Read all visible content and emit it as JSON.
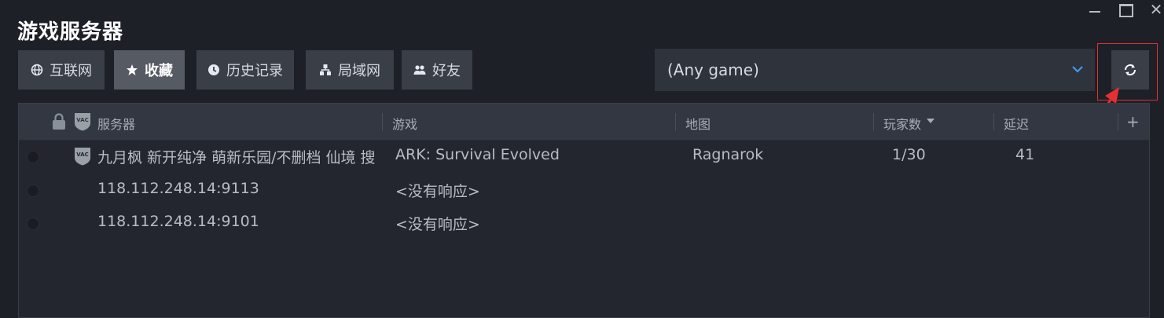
{
  "window": {
    "title": "游戏服务器",
    "close_glyph": "✕"
  },
  "tabs": [
    {
      "label": "互联网",
      "icon": "globe-icon",
      "active": false
    },
    {
      "label": "收藏",
      "icon": "star-icon",
      "active": true
    },
    {
      "label": "历史记录",
      "icon": "clock-icon",
      "active": false
    },
    {
      "label": "局域网",
      "icon": "lan-icon",
      "active": false
    },
    {
      "label": "好友",
      "icon": "friends-icon",
      "active": false
    }
  ],
  "game_filter": {
    "value": "(Any game)"
  },
  "refresh": {
    "icon": "refresh-icon"
  },
  "columns": {
    "server": "服务器",
    "game": "游戏",
    "map": "地图",
    "players": "玩家数",
    "latency": "延迟",
    "add": "+"
  },
  "rows": [
    {
      "vac": true,
      "server": "九月枫 新开纯净 萌新乐园/不删档 仙境 搜",
      "game": "ARK: Survival Evolved",
      "map": "Ragnarok",
      "players": "1/30",
      "latency": "41"
    },
    {
      "vac": false,
      "server": "118.112.248.14:9113",
      "game": "<没有响应>",
      "map": "",
      "players": "",
      "latency": ""
    },
    {
      "vac": false,
      "server": "118.112.248.14:9101",
      "game": "<没有响应>",
      "map": "",
      "players": "",
      "latency": ""
    }
  ],
  "vac_badge": "VAC",
  "colors": {
    "highlight": "#e03030",
    "active_tab": "#555a63",
    "tab": "#3a3e47",
    "accent_chevron": "#3d9be9"
  }
}
